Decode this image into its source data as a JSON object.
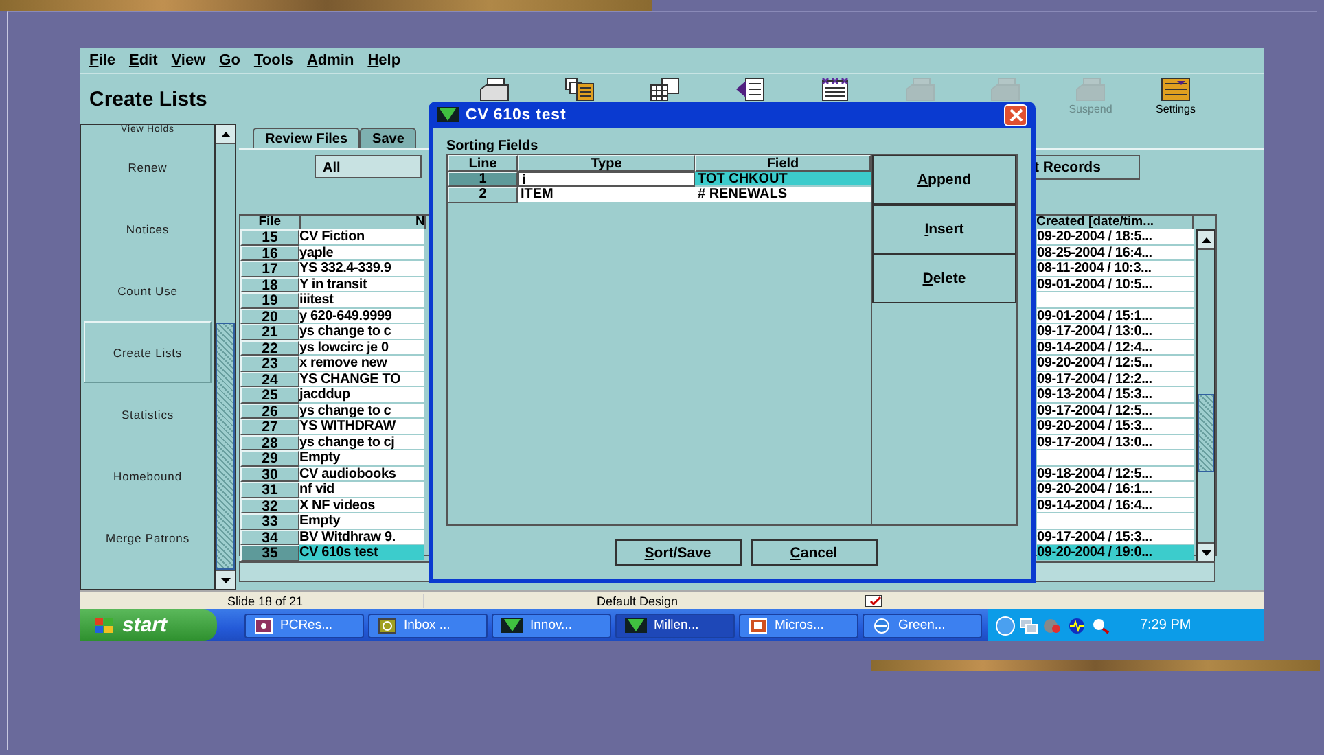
{
  "menu": [
    {
      "label": "File"
    },
    {
      "label": "Edit"
    },
    {
      "label": "View"
    },
    {
      "label": "Go"
    },
    {
      "label": "Tools"
    },
    {
      "label": "Admin"
    },
    {
      "label": "Help"
    }
  ],
  "page_title": "Create Lists",
  "toolbar": [
    {
      "kind": "printer",
      "disabled": false
    },
    {
      "kind": "stack",
      "disabled": false
    },
    {
      "kind": "grid",
      "disabled": false
    },
    {
      "kind": "arrow",
      "disabled": false
    },
    {
      "kind": "marked",
      "disabled": false
    },
    {
      "kind": "printer",
      "disabled": true
    },
    {
      "kind": "printer",
      "disabled": true
    },
    {
      "kind": "printer",
      "label": "Suspend",
      "disabled": true
    },
    {
      "kind": "settings",
      "label": "Settings",
      "disabled": false
    }
  ],
  "sidebar": {
    "items": [
      {
        "label": "View Holds",
        "selected": false
      },
      {
        "label": "Renew",
        "selected": false
      },
      {
        "label": "Notices",
        "selected": false
      },
      {
        "label": "Count Use",
        "selected": false
      },
      {
        "label": "Create Lists",
        "selected": true
      },
      {
        "label": "Statistics",
        "selected": false
      },
      {
        "label": "Homebound",
        "selected": false
      },
      {
        "label": "Merge Patrons",
        "selected": false
      }
    ]
  },
  "tabs": [
    {
      "label": "Review Files",
      "selected": true
    },
    {
      "label": "Save",
      "selected": false
    }
  ],
  "filter": {
    "value": "All"
  },
  "records_button": "t Records",
  "table": {
    "columns": [
      "File",
      "N",
      "Created [date/tim..."
    ],
    "rows": [
      {
        "file": "15",
        "name": "CV Fiction",
        "created": "09-20-2004 / 18:5...",
        "selected": false
      },
      {
        "file": "16",
        "name": "yaple",
        "created": "08-25-2004 / 16:4...",
        "selected": false
      },
      {
        "file": "17",
        "name": "YS 332.4-339.9",
        "created": "08-11-2004 / 10:3...",
        "selected": false
      },
      {
        "file": "18",
        "name": "Y in transit",
        "created": "09-01-2004 / 10:5...",
        "selected": false
      },
      {
        "file": "19",
        "name": "iiitest",
        "selected": false
      },
      {
        "file": "20",
        "name": "y 620-649.9999",
        "created": "09-01-2004 / 15:1...",
        "selected": false
      },
      {
        "file": "21",
        "name": "ys change to c",
        "created": "09-17-2004 / 13:0...",
        "selected": false
      },
      {
        "file": "22",
        "name": "ys lowcirc je 0",
        "created": "09-14-2004 / 12:4...",
        "selected": false
      },
      {
        "file": "23",
        "name": "x remove new",
        "created": "09-20-2004 / 12:5...",
        "selected": false
      },
      {
        "file": "24",
        "name": "YS CHANGE TO",
        "created": "09-17-2004 / 12:2...",
        "selected": false
      },
      {
        "file": "25",
        "name": "jacddup",
        "created": "09-13-2004 / 15:3...",
        "selected": false
      },
      {
        "file": "26",
        "name": "ys change to c",
        "created": "09-17-2004 / 12:5...",
        "selected": false
      },
      {
        "file": "27",
        "name": "YS WITHDRAW",
        "created": "09-20-2004 / 15:3...",
        "selected": false
      },
      {
        "file": "28",
        "name": "ys change to cj",
        "created": "09-17-2004 / 13:0...",
        "selected": false
      },
      {
        "file": "29",
        "name": "Empty",
        "selected": false
      },
      {
        "file": "30",
        "name": "CV audiobooks",
        "created": "09-18-2004 / 12:5...",
        "selected": false
      },
      {
        "file": "31",
        "name": "nf vid",
        "created": "09-20-2004 / 16:1...",
        "selected": false
      },
      {
        "file": "32",
        "name": "X NF videos",
        "created": "09-14-2004 / 16:4...",
        "selected": false
      },
      {
        "file": "33",
        "name": "Empty",
        "selected": false
      },
      {
        "file": "34",
        "name": "BV Witdhraw 9.",
        "created": "09-17-2004 / 15:3...",
        "selected": false
      },
      {
        "file": "35",
        "name": "CV 610s test",
        "created": "09-20-2004 / 19:0...",
        "selected": true
      }
    ]
  },
  "dialog": {
    "title": "CV 610s test",
    "section": "Sorting Fields",
    "columns": [
      "Line",
      "Type",
      "Field"
    ],
    "rows": [
      {
        "line": "1",
        "type": "i",
        "field": "TOT CHKOUT",
        "selected": true,
        "editing": true
      },
      {
        "line": "2",
        "type": "ITEM",
        "field": "# RENEWALS",
        "selected": false,
        "editing": false
      }
    ],
    "side_buttons": [
      "Append",
      "Insert",
      "Delete"
    ],
    "buttons": [
      "Sort/Save",
      "Cancel"
    ]
  },
  "status_bar": [
    "Slide 18 of 21",
    "Default Design"
  ],
  "taskbar": {
    "start": "start",
    "tasks": [
      {
        "label": "PCRes...",
        "kind": "app",
        "selected": false
      },
      {
        "label": "Inbox ...",
        "kind": "mail",
        "selected": false
      },
      {
        "label": "Innov...",
        "kind": "millennium",
        "selected": false
      },
      {
        "label": "Millen...",
        "kind": "millennium",
        "selected": true
      },
      {
        "label": "Micros...",
        "kind": "slides",
        "selected": false
      },
      {
        "label": "Green...",
        "kind": "browser",
        "selected": false
      }
    ],
    "clock": "7:29 PM"
  }
}
